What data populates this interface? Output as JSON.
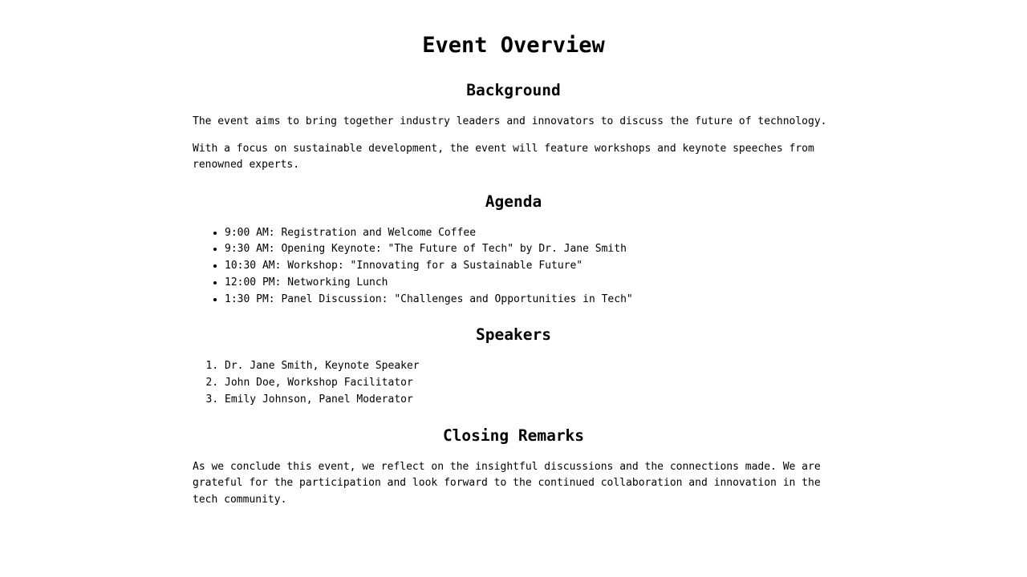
{
  "title": "Event Overview",
  "background": {
    "heading": "Background",
    "paragraphs": [
      "The event aims to bring together industry leaders and innovators to discuss the future of technology.",
      "With a focus on sustainable development, the event will feature workshops and keynote speeches from renowned experts."
    ]
  },
  "agenda": {
    "heading": "Agenda",
    "items": [
      "9:00 AM: Registration and Welcome Coffee",
      "9:30 AM: Opening Keynote: \"The Future of Tech\" by Dr. Jane Smith",
      "10:30 AM: Workshop: \"Innovating for a Sustainable Future\"",
      "12:00 PM: Networking Lunch",
      "1:30 PM: Panel Discussion: \"Challenges and Opportunities in Tech\""
    ]
  },
  "speakers": {
    "heading": "Speakers",
    "items": [
      "Dr. Jane Smith, Keynote Speaker",
      "John Doe, Workshop Facilitator",
      "Emily Johnson, Panel Moderator"
    ]
  },
  "closing": {
    "heading": "Closing Remarks",
    "paragraph": "As we conclude this event, we reflect on the insightful discussions and the connections made. We are grateful for the participation and look forward to the continued collaboration and innovation in the tech community."
  }
}
